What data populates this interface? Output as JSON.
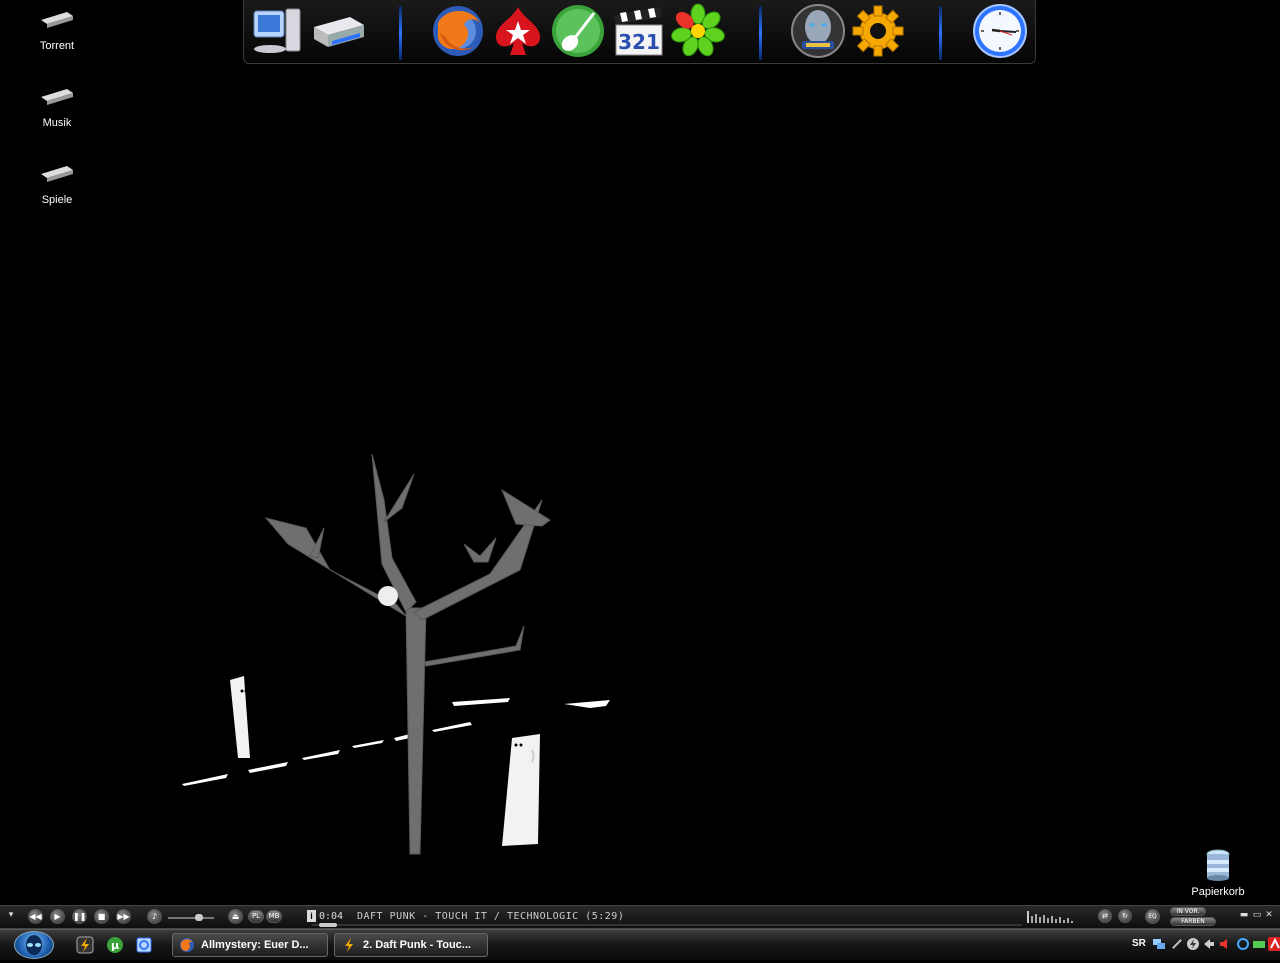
{
  "desktop": {
    "icons": [
      {
        "label": "Torrent",
        "icon": "folder-icon"
      },
      {
        "label": "Musik",
        "icon": "folder-icon"
      },
      {
        "label": "Spiele",
        "icon": "folder-icon"
      },
      {
        "label": "Papierkorb",
        "icon": "recycle-bin-icon"
      }
    ]
  },
  "dock": {
    "items": [
      {
        "name": "my-computer",
        "icon": "computer-icon"
      },
      {
        "name": "printer",
        "icon": "printer-icon"
      },
      {
        "name": "firefox",
        "icon": "firefox-icon"
      },
      {
        "name": "pokerstars",
        "icon": "pokerstars-icon"
      },
      {
        "name": "guitar-pro",
        "icon": "guitar-icon"
      },
      {
        "name": "media-player-classic",
        "icon": "media-player-icon"
      },
      {
        "name": "icq",
        "icon": "icq-flower-icon"
      },
      {
        "name": "warcraft",
        "icon": "warcraft-icon"
      },
      {
        "name": "settings",
        "icon": "gear-icon"
      },
      {
        "name": "clock",
        "icon": "clock-icon"
      }
    ],
    "clock_icon_text": "321"
  },
  "player": {
    "time": "0:04",
    "track": "DAFT PUNK - TOUCH IT / TECHNOLOGIC (5:29)",
    "buttons": [
      "previous",
      "play",
      "pause",
      "stop",
      "next"
    ],
    "pl_label": "PL",
    "mb_label": "MB",
    "eq_label": "EQ",
    "in_vor_label": "IN VOR.",
    "farben_label": "FARBEN",
    "volume_percent": 70,
    "progress_percent": 1
  },
  "taskbar": {
    "quicklaunch": [
      "winamp-icon",
      "utorrent-icon",
      "internet-icon"
    ],
    "tasks": [
      {
        "label": "Allmystery: Euer D...",
        "icon": "firefox-icon"
      },
      {
        "label": "2. Daft Punk - Touc...",
        "icon": "winamp-icon"
      }
    ],
    "tray_lang": "SR"
  },
  "colors": {
    "accent_blue": "#2f74ff",
    "background": "#000000"
  }
}
